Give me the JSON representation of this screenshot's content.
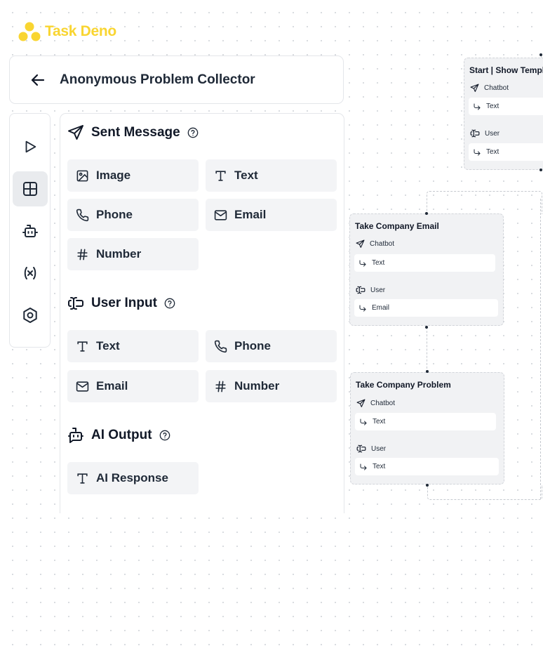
{
  "app": {
    "name": "Task Deno",
    "brand_color": "#f9d531"
  },
  "header": {
    "title": "Anonymous Problem Collector",
    "back_icon": "arrow-left-icon"
  },
  "rail": [
    {
      "icon": "play-icon",
      "active": false
    },
    {
      "icon": "grid-icon",
      "active": true
    },
    {
      "icon": "bot-icon",
      "active": false
    },
    {
      "icon": "variable-icon",
      "active": false
    },
    {
      "icon": "hexagon-settings-icon",
      "active": false
    }
  ],
  "panel": {
    "sent_message": {
      "label": "Sent Message",
      "items": [
        {
          "label": "Image",
          "icon": "image-icon"
        },
        {
          "label": "Text",
          "icon": "text-icon"
        },
        {
          "label": "Phone",
          "icon": "phone-icon"
        },
        {
          "label": "Email",
          "icon": "mail-icon"
        },
        {
          "label": "Number",
          "icon": "hash-icon"
        }
      ]
    },
    "user_input": {
      "label": "User Input",
      "items": [
        {
          "label": "Text",
          "icon": "text-icon"
        },
        {
          "label": "Phone",
          "icon": "phone-icon"
        },
        {
          "label": "Email",
          "icon": "mail-icon"
        },
        {
          "label": "Number",
          "icon": "hash-icon"
        }
      ]
    },
    "ai_output": {
      "label": "AI Output",
      "items": [
        {
          "label": "AI Response",
          "icon": "text-icon"
        }
      ]
    }
  },
  "canvas": {
    "nodes": [
      {
        "title": "Start | Show Templat",
        "chatbot_label": "Chatbot",
        "chatbot_field": "Text",
        "user_label": "User",
        "user_field": "Text"
      },
      {
        "title": "Take Company Email",
        "chatbot_label": "Chatbot",
        "chatbot_field": "Text",
        "user_label": "User",
        "user_field": "Email"
      },
      {
        "title": "Take Company Problem",
        "chatbot_label": "Chatbot",
        "chatbot_field": "Text",
        "user_label": "User",
        "user_field": "Text"
      }
    ]
  }
}
